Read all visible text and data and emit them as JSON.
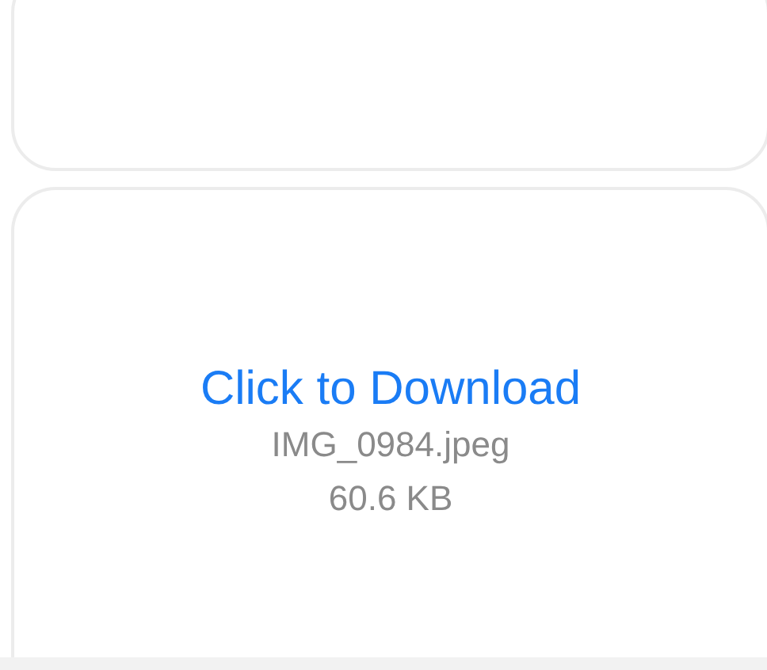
{
  "cards": [
    {
      "kind": "empty"
    },
    {
      "kind": "download",
      "link": "Click to Download",
      "filename": "IMG_0984.jpeg",
      "size": "60.6 KB"
    }
  ]
}
